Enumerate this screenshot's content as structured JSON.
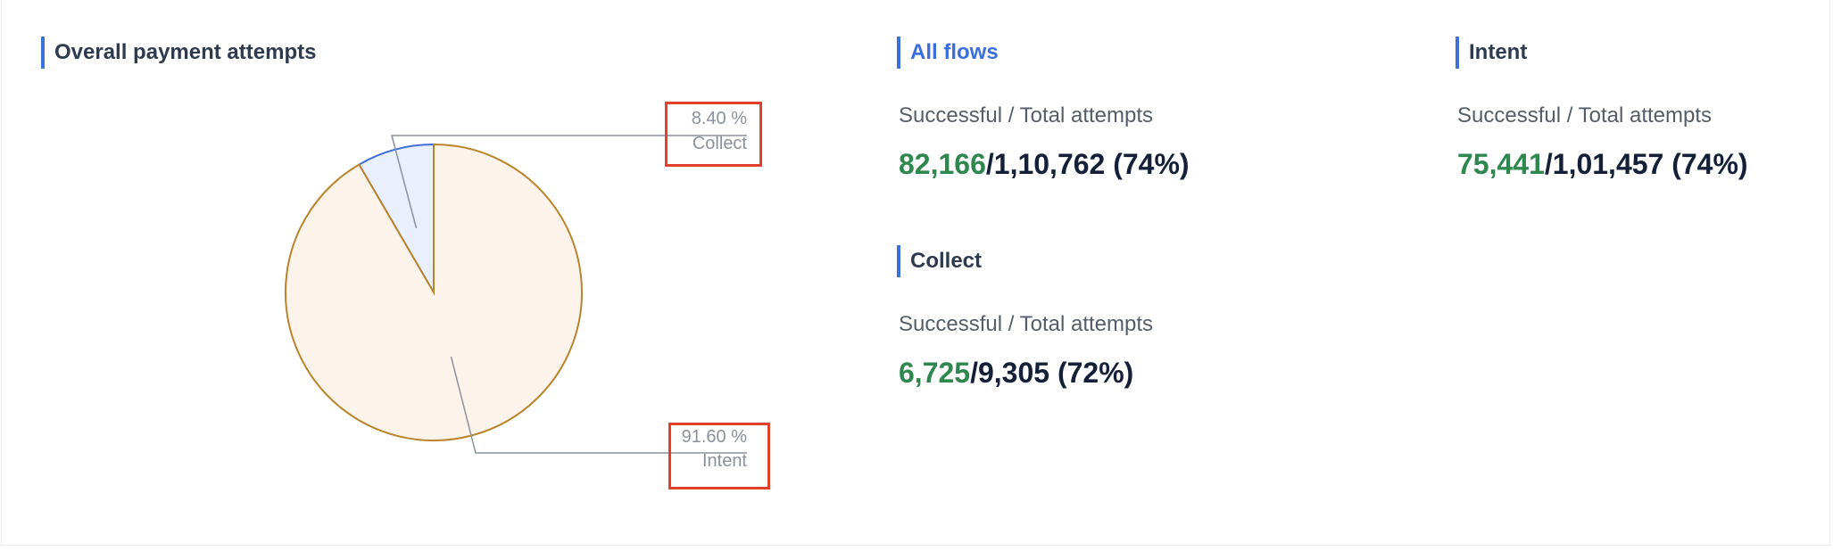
{
  "chart_title": "Overall payment attempts",
  "chart_data": {
    "type": "pie",
    "title": "Overall payment attempts",
    "slices": [
      {
        "name": "Collect",
        "value": 8.4,
        "label": "8.40 %",
        "color": "#3f6fd8",
        "fill": "#e9f0fb"
      },
      {
        "name": "Intent",
        "value": 91.6,
        "label": "91.60 %",
        "color": "#b8842c",
        "fill": "#fcf3ea"
      }
    ]
  },
  "panels": {
    "all_flows": {
      "title": "All flows",
      "caption": "Successful / Total attempts",
      "successful": "82,166",
      "rest": "/1,10,762 (74%)"
    },
    "intent": {
      "title": "Intent",
      "caption": "Successful / Total attempts",
      "successful": "75,441",
      "rest": "/1,01,457 (74%)"
    },
    "collect": {
      "title": "Collect",
      "caption": "Successful / Total attempts",
      "successful": "6,725",
      "rest": "/9,305 (72%)"
    }
  },
  "colors": {
    "accent": "#3f6fd8",
    "success": "#2f8750",
    "highlight_box": "#e0412a"
  }
}
